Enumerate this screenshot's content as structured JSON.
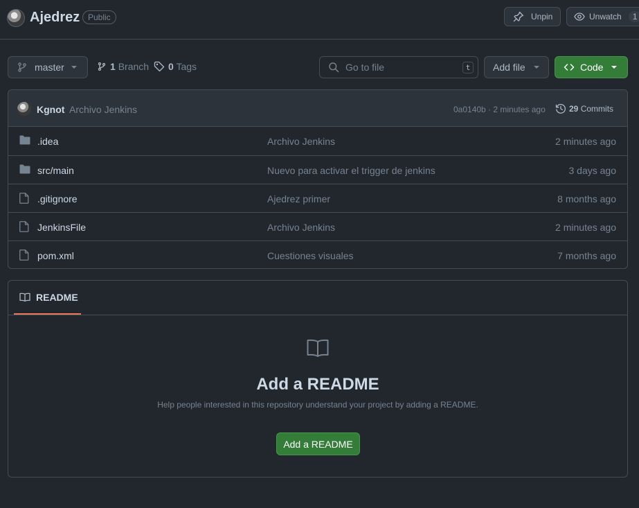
{
  "header": {
    "repo_name": "Ajedrez",
    "visibility": "Public",
    "unpin_label": "Unpin",
    "unwatch_label": "Unwatch",
    "watch_count": "1"
  },
  "toolbar": {
    "branch": "master",
    "branch_count": "1",
    "branch_label": "Branch",
    "tag_count": "0",
    "tag_label": "Tags",
    "search_placeholder": "Go to file",
    "search_shortcut": "t",
    "add_file_label": "Add file",
    "code_label": "Code"
  },
  "commit": {
    "author": "Kgnot",
    "message": "Archivo Jenkins",
    "meta": "0a0140b · 2 minutes ago",
    "commits_count": "29",
    "commits_label": "Commits"
  },
  "files": [
    {
      "name": ".idea",
      "type": "folder",
      "commit": "Archivo Jenkins",
      "age": "2 minutes ago"
    },
    {
      "name": "src/main",
      "type": "folder",
      "commit": "Nuevo para activar el trigger de jenkins",
      "age": "3 days ago"
    },
    {
      "name": ".gitignore",
      "type": "file",
      "commit": "Ajedrez primer",
      "age": "8 months ago"
    },
    {
      "name": "JenkinsFile",
      "type": "file",
      "commit": "Archivo Jenkins",
      "age": "2 minutes ago"
    },
    {
      "name": "pom.xml",
      "type": "file",
      "commit": "Cuestiones visuales",
      "age": "7 months ago"
    }
  ],
  "readme": {
    "tab_label": "README",
    "title": "Add a README",
    "subtitle": "Help people interested in this repository understand your project by adding a README.",
    "button_label": "Add a README"
  },
  "colors": {
    "background": "#22272e",
    "border": "#444c56",
    "primary_button": "#347d39",
    "tab_underline": "#ec775c"
  }
}
